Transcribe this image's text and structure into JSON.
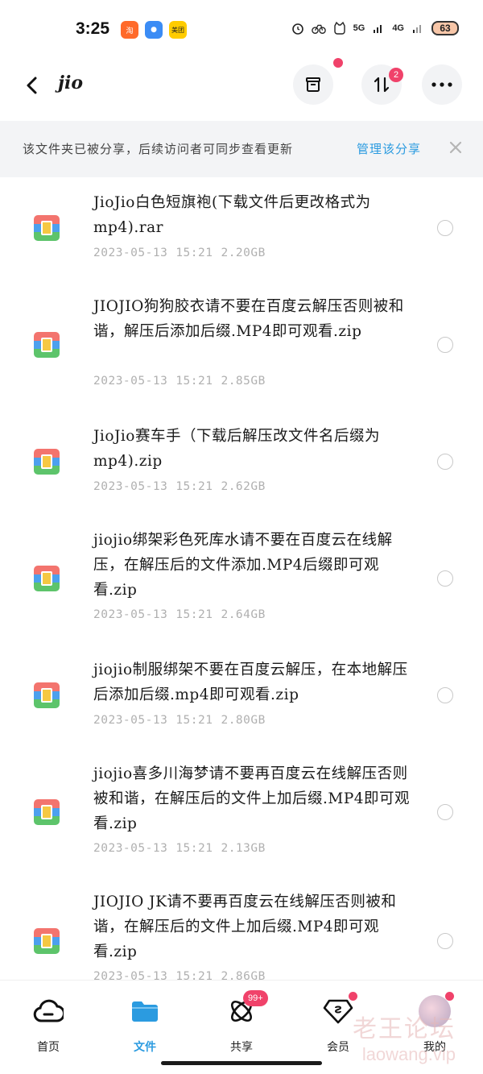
{
  "status_bar": {
    "time": "3:25",
    "apps": [
      {
        "name": "taobao-app-icon",
        "glyph": "淘",
        "color": "#ff6a2a"
      },
      {
        "name": "cloud-app-icon",
        "glyph": "●",
        "color": "#3b8cf5"
      },
      {
        "name": "meituan-app-icon",
        "glyph": "美团",
        "color": "#ffcc00"
      }
    ],
    "signal_5g": "5G",
    "signal_4g": "4G",
    "battery": "63"
  },
  "header": {
    "title": "jio",
    "transfer_badge": "2"
  },
  "share_banner": {
    "text": "该文件夹已被分享，后续访问者可同步查看更新",
    "manage_link": "管理该分享"
  },
  "files": [
    {
      "name": "JioJio白色短旗袍(下载文件后更改格式为mp4).rar",
      "date": "2023-05-13",
      "time": "15:21",
      "size": "2.20GB"
    },
    {
      "name": "JIOJIO狗狗胶衣请不要在百度云解压否则被和谐，解压后添加后缀.MP4即可观看.zip",
      "date": "2023-05-13",
      "time": "15:21",
      "size": "2.85GB"
    },
    {
      "name": "JioJio赛车手（下载后解压改文件名后缀为mp4).zip",
      "date": "2023-05-13",
      "time": "15:21",
      "size": "2.62GB"
    },
    {
      "name": "jiojio绑架彩色死库水请不要在百度云在线解压，在解压后的文件添加.MP4后缀即可观看.zip",
      "date": "2023-05-13",
      "time": "15:21",
      "size": "2.64GB"
    },
    {
      "name": "jiojio制服绑架不要在百度云解压，在本地解压后添加后缀.mp4即可观看.zip",
      "date": "2023-05-13",
      "time": "15:21",
      "size": "2.80GB"
    },
    {
      "name": "jiojio喜多川海梦请不要再百度云在线解压否则被和谐，在解压后的文件上加后缀.MP4即可观看.zip",
      "date": "2023-05-13",
      "time": "15:21",
      "size": "2.13GB"
    },
    {
      "name": "JIOJIO JK请不要再百度云在线解压否则被和谐，在解压后的文件上加后缀.MP4即可观看.zip",
      "date": "2023-05-13",
      "time": "15:21",
      "size": "2.86GB"
    }
  ],
  "bottom_nav": {
    "items": [
      {
        "label": "首页"
      },
      {
        "label": "文件"
      },
      {
        "label": "共享",
        "badge": "99+"
      },
      {
        "label": "会员"
      },
      {
        "label": "我的"
      }
    ]
  },
  "watermark": {
    "cn": "老王论坛",
    "url": "laowang.vip"
  },
  "colors": {
    "accent": "#2b9be0",
    "badge": "#f0426a",
    "meta_text": "#b0b0b0"
  }
}
